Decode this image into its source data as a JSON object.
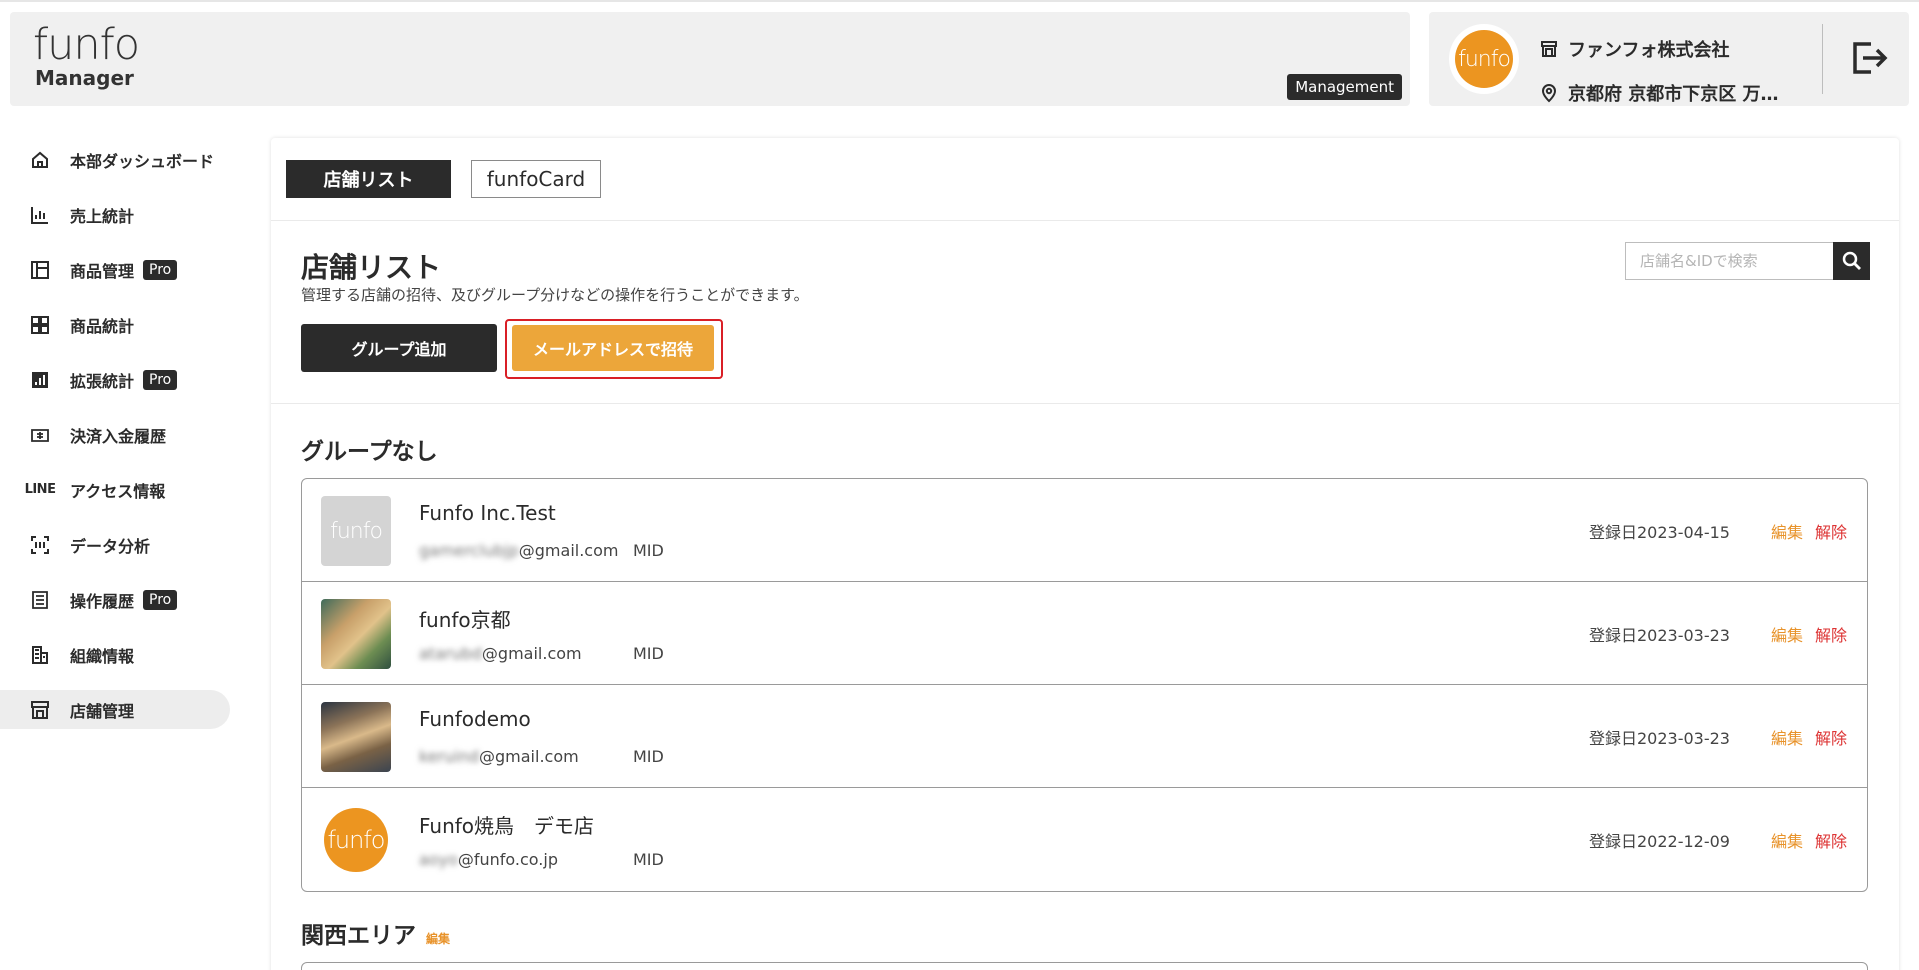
{
  "header": {
    "logo_text": "funfo",
    "logo_sub": "Manager",
    "mode_badge": "Management",
    "account": {
      "avatar_text": "funfo",
      "company": "ファンフォ株式会社",
      "address": "京都府 京都市下京区 万…"
    }
  },
  "sidebar": {
    "items": [
      {
        "label": "本部ダッシュボード",
        "icon": "home-icon",
        "pro": ""
      },
      {
        "label": "売上統計",
        "icon": "bar-chart-icon",
        "pro": ""
      },
      {
        "label": "商品管理",
        "icon": "layout-icon",
        "pro": "Pro"
      },
      {
        "label": "商品統計",
        "icon": "grid-icon",
        "pro": ""
      },
      {
        "label": "拡張統計",
        "icon": "analytics-icon",
        "pro": "Pro"
      },
      {
        "label": "決済入金履歴",
        "icon": "payment-icon",
        "pro": ""
      },
      {
        "label": "アクセス情報",
        "icon": "line-logo-icon",
        "pro": ""
      },
      {
        "label": "データ分析",
        "icon": "scan-icon",
        "pro": ""
      },
      {
        "label": "操作履歴",
        "icon": "list-icon",
        "pro": "Pro"
      },
      {
        "label": "組織情報",
        "icon": "building-icon",
        "pro": ""
      },
      {
        "label": "店舗管理",
        "icon": "store-icon",
        "pro": ""
      }
    ],
    "line_icon_text": "LINE"
  },
  "main": {
    "tabs": [
      {
        "label": "店舗リスト"
      },
      {
        "label": "funfoCard"
      }
    ],
    "title": "店舗リスト",
    "description": "管理する店舗の招待、及びグループ分けなどの操作を行うことができます。",
    "search": {
      "placeholder": "店舗名&IDで検索",
      "value": ""
    },
    "add_group_button": "グループ追加",
    "invite_button": "メールアドレスで招待",
    "groups": [
      {
        "title": "グループなし",
        "edit_label": "",
        "stores": [
          {
            "name": "Funfo Inc.Test",
            "email_hidden": "gamerclubjp",
            "email_domain": "@gmail.com",
            "mid": "MID",
            "date": "登録日2023-04-15",
            "edit": "編集",
            "remove": "解除",
            "thumb_text": "funfo"
          },
          {
            "name": "funfo京都",
            "email_hidden": "atarubd",
            "email_domain": "@gmail.com",
            "mid": "MID",
            "date": "登録日2023-03-23",
            "edit": "編集",
            "remove": "解除",
            "thumb_text": ""
          },
          {
            "name": "Funfodemo",
            "email_hidden": "keruind",
            "email_domain": "@gmail.com",
            "mid": "MID",
            "date": "登録日2023-03-23",
            "edit": "編集",
            "remove": "解除",
            "thumb_text": ""
          },
          {
            "name": "Funfo焼鳥　デモ店",
            "email_hidden": "aoyo",
            "email_domain": "@funfo.co.jp",
            "mid": "MID",
            "date": "登録日2022-12-09",
            "edit": "編集",
            "remove": "解除",
            "thumb_text": "funfo"
          }
        ]
      },
      {
        "title": "関西エリア",
        "edit_label": "編集",
        "stores": []
      }
    ]
  },
  "colors": {
    "accent_orange": "#eca63a",
    "dark": "#2b2b2b",
    "highlight_red": "#d91f26",
    "remove_red": "#dd3333"
  }
}
